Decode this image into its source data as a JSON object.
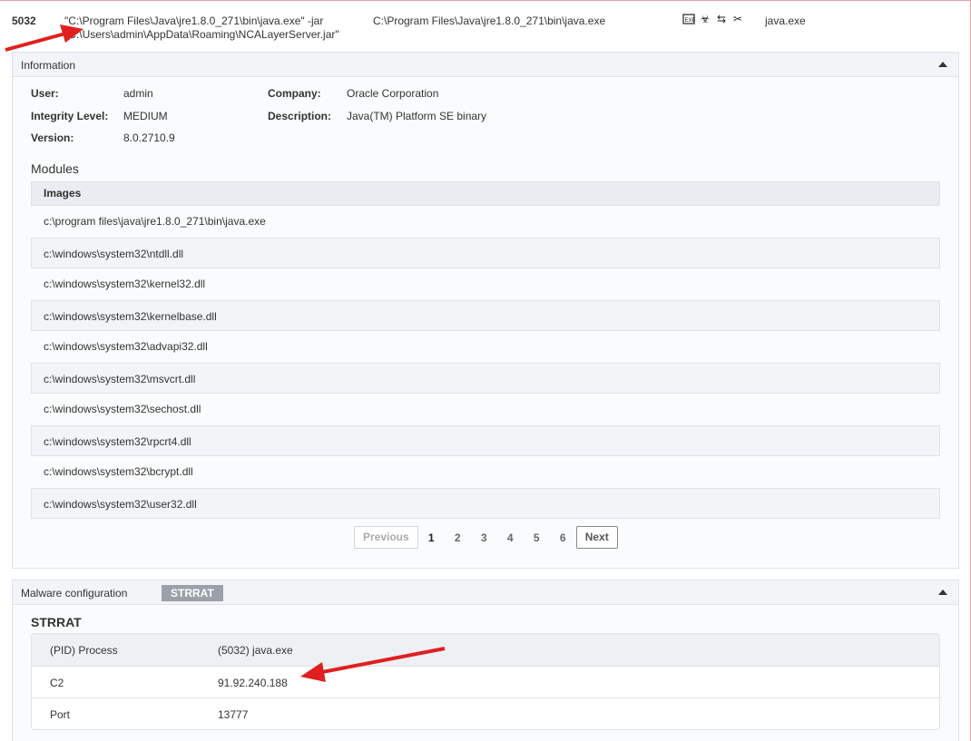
{
  "process": {
    "pid": "5032",
    "cmd_line1": "\"C:\\Program Files\\Java\\jre1.8.0_271\\bin\\java.exe\" -jar",
    "cmd_line2": "\"C:\\Users\\admin\\AppData\\Roaming\\NCALayerServer.jar\"",
    "path": "C:\\Program Files\\Java\\jre1.8.0_271\\bin\\java.exe",
    "icons": [
      "exe-icon",
      "biohazard-icon",
      "network-arrows-icon",
      "tools-icon"
    ],
    "name": "java.exe"
  },
  "info": {
    "title": "Information",
    "user_label": "User:",
    "user": "admin",
    "integrity_label": "Integrity Level:",
    "integrity": "MEDIUM",
    "version_label": "Version:",
    "version": "8.0.2710.9",
    "company_label": "Company:",
    "company": "Oracle Corporation",
    "description_label": "Description:",
    "description": "Java(TM) Platform SE binary"
  },
  "modules": {
    "title": "Modules",
    "header": "Images",
    "rows": [
      "c:\\program files\\java\\jre1.8.0_271\\bin\\java.exe",
      "c:\\windows\\system32\\ntdll.dll",
      "c:\\windows\\system32\\kernel32.dll",
      "c:\\windows\\system32\\kernelbase.dll",
      "c:\\windows\\system32\\advapi32.dll",
      "c:\\windows\\system32\\msvcrt.dll",
      "c:\\windows\\system32\\sechost.dll",
      "c:\\windows\\system32\\rpcrt4.dll",
      "c:\\windows\\system32\\bcrypt.dll",
      "c:\\windows\\system32\\user32.dll"
    ]
  },
  "pager": {
    "previous": "Previous",
    "next": "Next",
    "pages": [
      "1",
      "2",
      "3",
      "4",
      "5",
      "6"
    ],
    "current": "1"
  },
  "malware": {
    "title": "Malware configuration",
    "badge": "STRRAT",
    "family_title": "STRRAT",
    "rows": [
      {
        "key": "(PID) Process",
        "value": "(5032) java.exe"
      },
      {
        "key": "C2",
        "value": "91.92.240.188"
      },
      {
        "key": "Port",
        "value": "13777"
      }
    ]
  },
  "colors": {
    "arrow": "#e02020",
    "panel_border": "#dde3ea",
    "badge_bg": "#9aa1a8"
  }
}
